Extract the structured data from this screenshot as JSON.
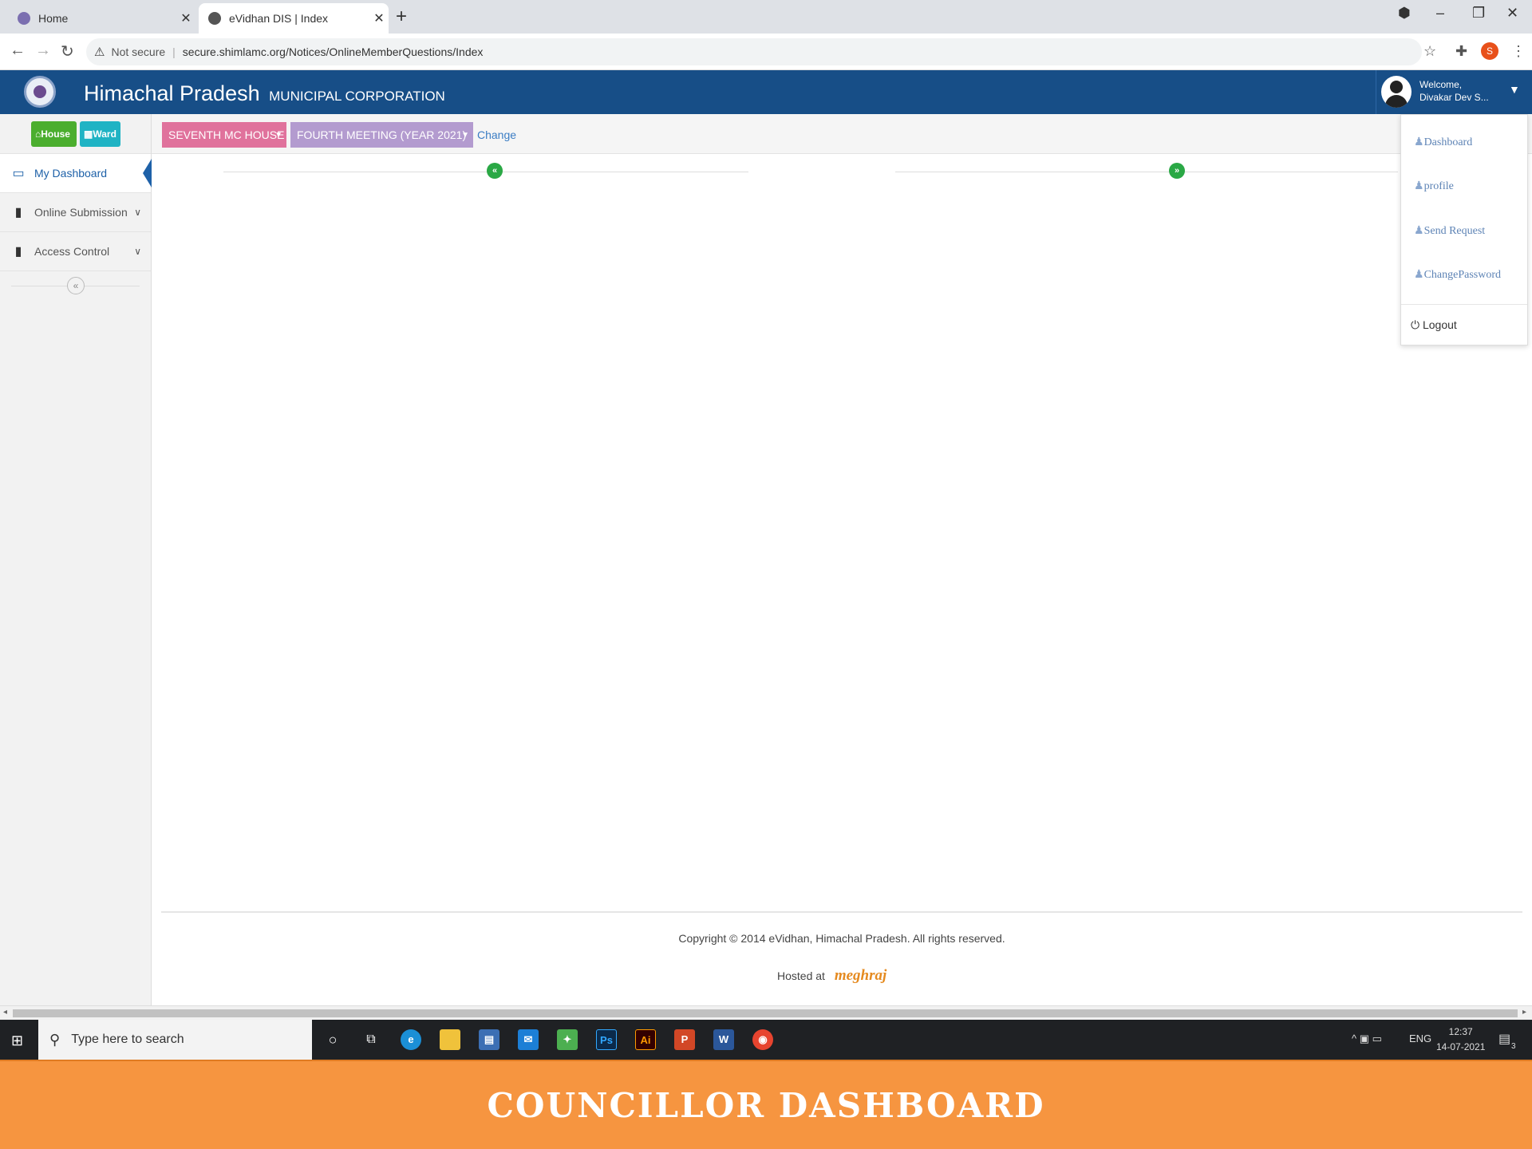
{
  "browser": {
    "tabs": [
      {
        "title": "Home",
        "active": false
      },
      {
        "title": "eVidhan DIS | Index",
        "active": true
      }
    ],
    "new_tab": "+",
    "security_label": "Not secure",
    "url": "secure.shimlamc.org/Notices/OnlineMemberQuestions/Index",
    "profile_initial": "S",
    "window_controls": [
      "–",
      "❐",
      "✕"
    ]
  },
  "header": {
    "title": "Himachal Pradesh",
    "subtitle": "MUNICIPAL CORPORATION",
    "welcome_line1": "Welcome,",
    "welcome_line2": "Divakar Dev S..."
  },
  "sidebar": {
    "buttons": [
      {
        "label": "House",
        "color": "#4bae2e"
      },
      {
        "label": "Ward",
        "color": "#1fb3c4"
      }
    ],
    "items": [
      {
        "label": "My Dashboard",
        "icon": "monitor-icon",
        "active": true
      },
      {
        "label": "Online Submission",
        "icon": "bookmark-icon",
        "active": false
      },
      {
        "label": "Access Control",
        "icon": "bookmark-icon",
        "active": false
      }
    ]
  },
  "filters": {
    "house_select": "SEVENTH MC HOUSE",
    "meeting_select": "FOURTH MEETING (YEAR 2021)",
    "change_link": "Change"
  },
  "user_menu": {
    "items": [
      "Dashboard",
      "profile",
      "Send Request",
      "ChangePassword"
    ],
    "logout": "Logout"
  },
  "footer": {
    "copyright": "Copyright © 2014 eVidhan, Himachal Pradesh. All rights reserved.",
    "hosted_at": "Hosted at",
    "host_logo": "meghraj"
  },
  "taskbar": {
    "search_placeholder": "Type here to search",
    "language": "ENG",
    "time": "12:37",
    "date": "14-07-2021",
    "notification_count": "3"
  },
  "banner": {
    "text": "COUNCILLOR DASHBOARD",
    "color": "#f69540"
  },
  "colors": {
    "header_blue": "#174e87",
    "house_select": "#e0729c",
    "meeting_select": "#b39bcf",
    "accent_green": "#2aa845"
  }
}
